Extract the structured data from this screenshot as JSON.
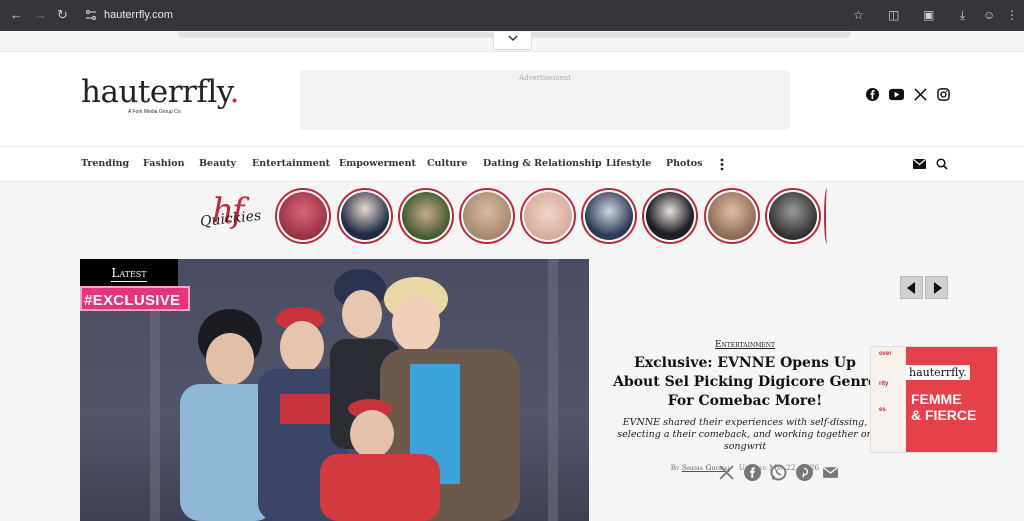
{
  "browser": {
    "url": "hauterrfly.com",
    "colors": {
      "toolbar": "#35363a",
      "text": "#e8e8e8"
    }
  },
  "header": {
    "logo_text": "hauterrfly",
    "logo_dot": ".",
    "logo_tagline": "A Fork Media Group Co.",
    "ad_label": "Advertisement",
    "socials": [
      "facebook-icon",
      "youtube-icon",
      "x-icon",
      "instagram-icon"
    ]
  },
  "nav": {
    "items": [
      "Trending",
      "Fashion",
      "Beauty",
      "Entertainment",
      "Empowerment",
      "Culture",
      "Dating & Relationship",
      "Lifestyle",
      "Photos"
    ]
  },
  "quickies": {
    "brand": "hf",
    "label": "Quickies",
    "story_colors": [
      "#a8323f",
      "#2f3a55",
      "#5a6b3b",
      "#c9a38a",
      "#e7c3b3",
      "#3b4b68",
      "#2a2a33",
      "#b08a72",
      "#6b6b6b"
    ]
  },
  "featured": {
    "badge_latest": "Latest",
    "badge_exclusive": "#EXCLUSIVE",
    "category": "Entertainment",
    "headline": "Exclusive: EVNNE Opens Up About Sel Picking Digicore Genre For Comebac More!",
    "summary": "EVNNE shared their experiences with self-dissing, selecting a their comeback, and working together on songwrit",
    "by_label": "By",
    "author": "Sneha Ghorai",
    "updated": "Updated May 22, 2026"
  },
  "magazine": {
    "logo": "hauterrfly.",
    "cover_text_1": "FEMME",
    "cover_text_2": "& FIERCE",
    "side_1": "over",
    "side_2": "rity",
    "side_3": "es"
  },
  "colors": {
    "brand_red": "#c2263d",
    "exclusive_pink": "#e8327a"
  }
}
